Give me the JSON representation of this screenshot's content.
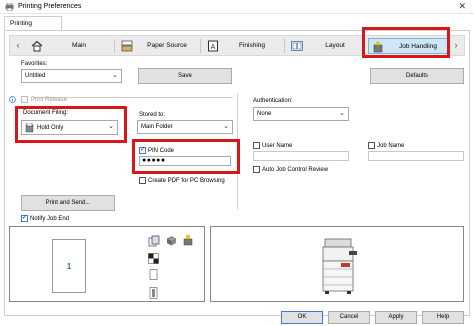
{
  "window": {
    "title": "Printing Preferences",
    "close_glyph": "✕"
  },
  "tab": {
    "label": "Printing Preferences"
  },
  "nav": {
    "items": [
      {
        "label": "Main",
        "icon": "home-icon"
      },
      {
        "label": "Paper Source",
        "icon": "paper-tray-icon"
      },
      {
        "label": "Finishing",
        "icon": "finishing-icon"
      },
      {
        "label": "Layout",
        "icon": "layout-icon"
      },
      {
        "label": "Job Handling",
        "icon": "job-handling-icon",
        "active": true
      }
    ],
    "left_arrow": "‹",
    "right_arrow": "›"
  },
  "favorites": {
    "label": "Favorites:",
    "value": "Untitled",
    "save_label": "Save",
    "defaults_label": "Defaults"
  },
  "print_release": {
    "label": "Print Release"
  },
  "document_filing": {
    "label": "Document Filing:",
    "value": "Hold Only"
  },
  "stored_to": {
    "label": "Stored to:",
    "value": "Main Folder"
  },
  "pin": {
    "label": "PIN Code",
    "value": "●●●●●",
    "checked": true
  },
  "create_pdf": {
    "label": "Create PDF for PC Browsing"
  },
  "authentication": {
    "label": "Authentication:",
    "value": "None"
  },
  "user_name": {
    "label": "User Name"
  },
  "job_name": {
    "label": "Job Name"
  },
  "auto_job_control": {
    "label": "Auto Job Control Review"
  },
  "print_send": {
    "label": "Print and Send..."
  },
  "notify_job_end": {
    "label": "Notify Job End",
    "checked": true
  },
  "preview": {
    "page_number": "1"
  },
  "check_glyph": "✓",
  "chevron_glyph": "⌄",
  "bottom_buttons": {
    "ok": "OK",
    "cancel": "Cancel",
    "apply": "Apply",
    "help": "Help"
  },
  "colors": {
    "highlight": "#d9161a",
    "active_tab": "#cfe6f7",
    "accent": "#3a7bd5"
  }
}
